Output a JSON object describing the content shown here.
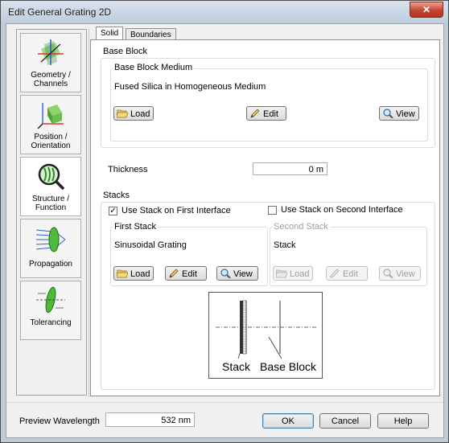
{
  "window": {
    "title": "Edit General Grating 2D",
    "close_icon": "✕"
  },
  "sidebar": {
    "items": [
      {
        "label_line1": "Geometry /",
        "label_line2": "Channels",
        "icon": "axes-3d-icon"
      },
      {
        "label_line1": "Position /",
        "label_line2": "Orientation",
        "icon": "cube-axes-icon"
      },
      {
        "label_line1": "Structure /",
        "label_line2": "Function",
        "icon": "magnifier-grating-icon"
      },
      {
        "label_line1": "Propagation",
        "label_line2": "",
        "icon": "lens-rays-icon"
      },
      {
        "label_line1": "Tolerancing",
        "label_line2": "",
        "icon": "lens-tolerance-icon"
      }
    ]
  },
  "tabs": [
    {
      "label": "Solid"
    },
    {
      "label": "Boundaries"
    }
  ],
  "base_block": {
    "group_label": "Base Block",
    "medium_label": "Base Block Medium",
    "medium_value": "Fused Silica in Homogeneous Medium",
    "load_label": "Load",
    "edit_label": "Edit",
    "view_label": "View"
  },
  "thickness": {
    "label": "Thickness",
    "value": "0 m"
  },
  "stacks": {
    "group_label": "Stacks",
    "first_checkbox_label": "Use Stack on First Interface",
    "first_checked_mark": "✓",
    "second_checkbox_label": "Use Stack on Second Interface",
    "first_stack_label": "First Stack",
    "first_stack_value": "Sinusoidal Grating",
    "second_stack_label": "Second Stack",
    "second_stack_value": "Stack",
    "load_label": "Load",
    "edit_label": "Edit",
    "view_label": "View"
  },
  "diagram": {
    "stack_label": "Stack",
    "base_block_label": "Base Block"
  },
  "footer": {
    "preview_label": "Preview Wavelength",
    "preview_value": "532 nm",
    "ok_label": "OK",
    "cancel_label": "Cancel",
    "help_label": "Help"
  }
}
